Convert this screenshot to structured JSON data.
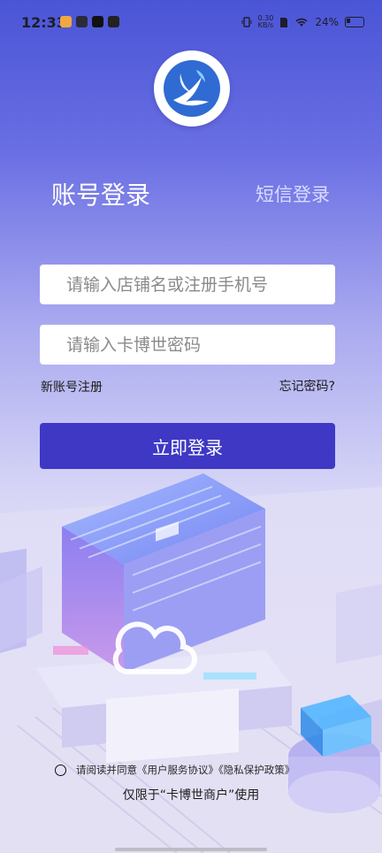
{
  "status_bar": {
    "time": "12:33",
    "net_speed_value": "0.30",
    "net_speed_unit": "KB/s",
    "battery_percent": "24%"
  },
  "tabs": {
    "account_login": "账号登录",
    "sms_login": "短信登录"
  },
  "form": {
    "store_placeholder": "请输入店铺名或注册手机号",
    "password_placeholder": "请输入卡博世密码",
    "register_link": "新账号注册",
    "forgot_link": "忘记密码?",
    "login_button": "立即登录"
  },
  "agreement": {
    "text": "请阅读并同意《用户服务协议》《隐私保护政策》",
    "restriction": "仅限于“卡博世商户”使用"
  },
  "colors": {
    "primary_button": "#3f38c5",
    "background_top": "#4a55d6"
  }
}
